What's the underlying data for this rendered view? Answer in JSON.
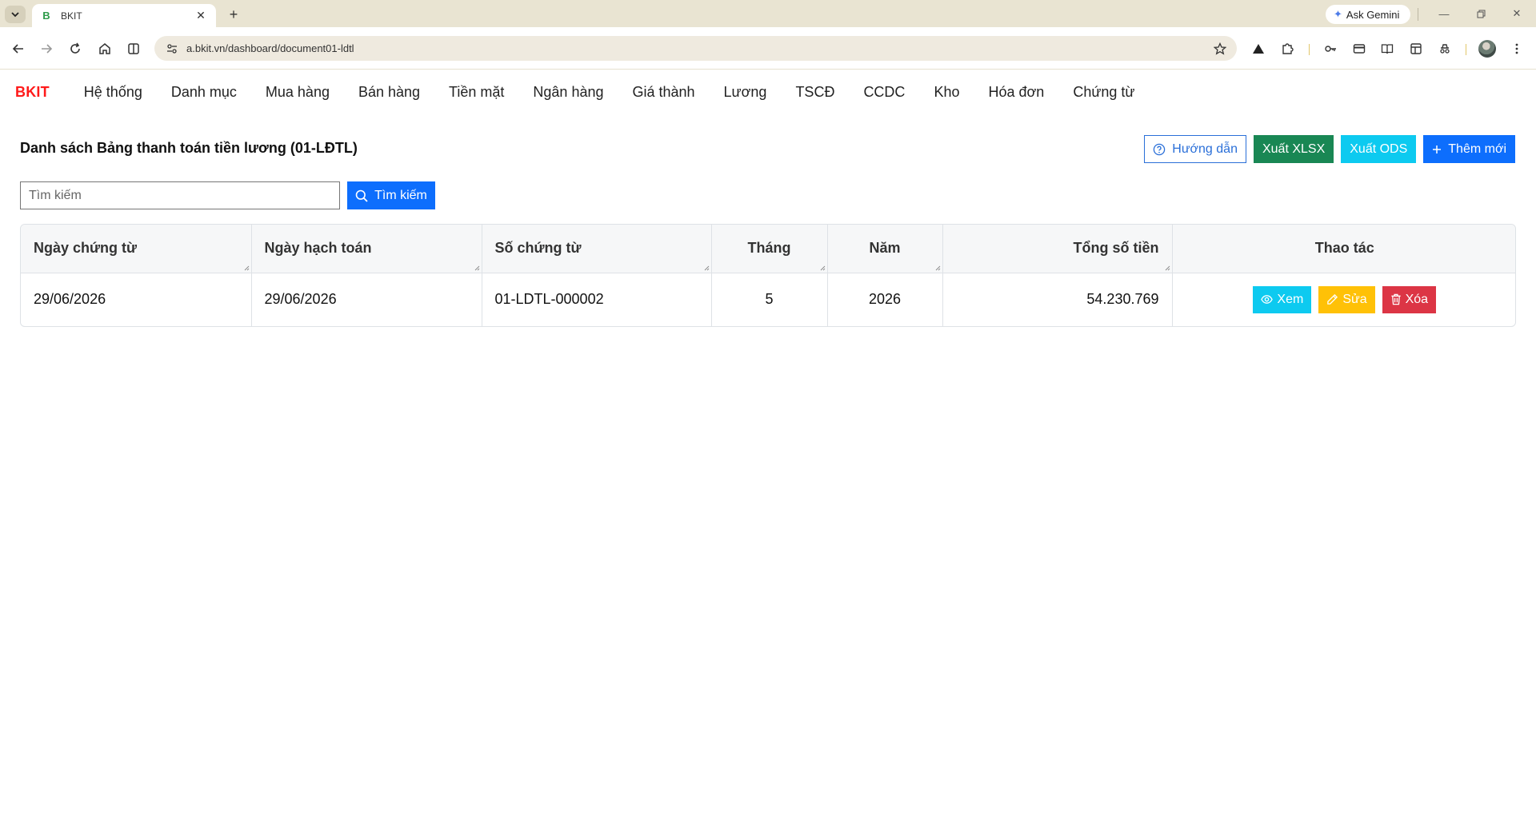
{
  "browser": {
    "tab_title": "BKIT",
    "tab_favicon_letter": "B",
    "gemini_label": "Ask Gemini",
    "url": "a.bkit.vn/dashboard/document01-ldtl"
  },
  "nav": {
    "brand": "BKIT",
    "items": [
      "Hệ thống",
      "Danh mục",
      "Mua hàng",
      "Bán hàng",
      "Tiền mặt",
      "Ngân hàng",
      "Giá thành",
      "Lương",
      "TSCĐ",
      "CCDC",
      "Kho",
      "Hóa đơn",
      "Chứng từ"
    ]
  },
  "page": {
    "title": "Danh sách Bảng thanh toán tiền lương (01-LĐTL)",
    "buttons": {
      "guide": "Hướng dẫn",
      "export_xlsx": "Xuất XLSX",
      "export_ods": "Xuất ODS",
      "add_new": "Thêm mới"
    },
    "search": {
      "placeholder": "Tìm kiếm",
      "button": "Tìm kiếm"
    }
  },
  "table": {
    "columns": [
      "Ngày chứng từ",
      "Ngày hạch toán",
      "Số chứng từ",
      "Tháng",
      "Năm",
      "Tổng số tiền",
      "Thao tác"
    ],
    "rows": [
      {
        "ngay_chung_tu": "29/06/2026",
        "ngay_hach_toan": "29/06/2026",
        "so_chung_tu": "01-LDTL-000002",
        "thang": "5",
        "nam": "2026",
        "tong_so_tien": "54.230.769"
      }
    ],
    "row_actions": {
      "view": "Xem",
      "edit": "Sửa",
      "delete": "Xóa"
    }
  },
  "colors": {
    "brand": "#ff1a1a",
    "primary": "#0d6efd",
    "success": "#198754",
    "info": "#0dcaf0",
    "warning": "#ffc107",
    "danger": "#dc3545"
  }
}
